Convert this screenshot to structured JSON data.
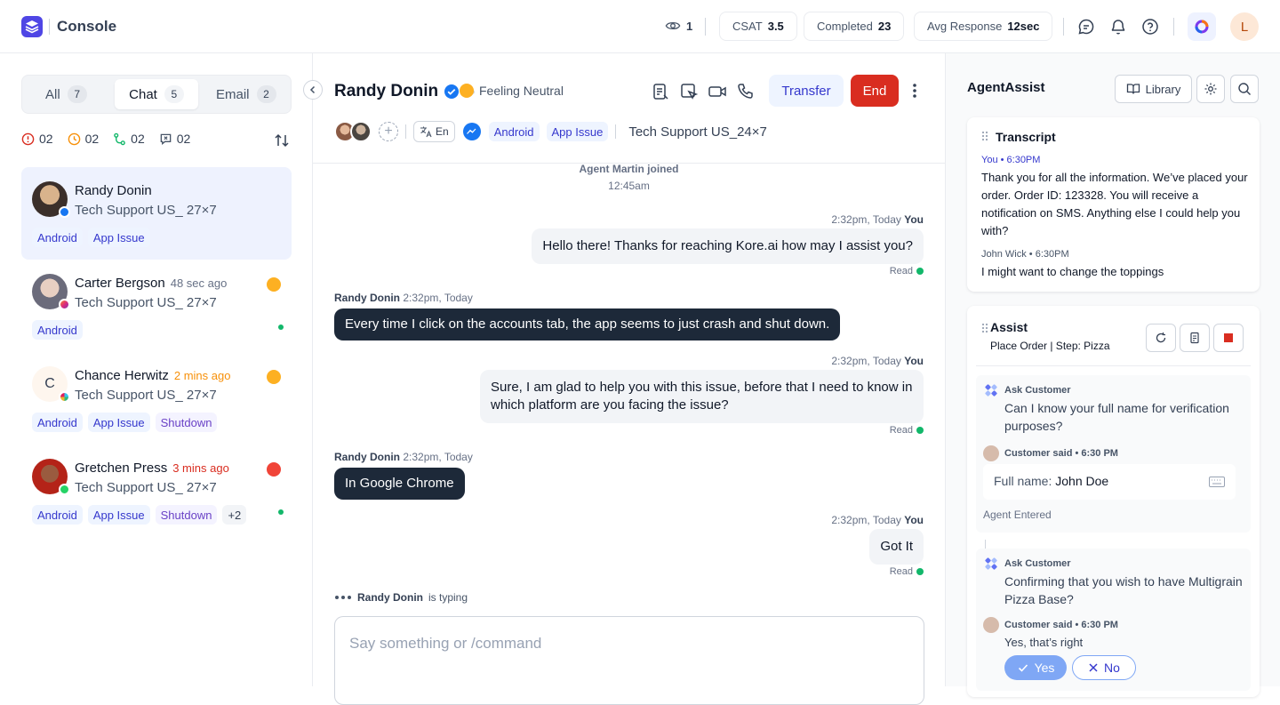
{
  "app": {
    "title": "Console"
  },
  "topbar": {
    "viewers": "1",
    "csat_label": "CSAT",
    "csat_value": "3.5",
    "completed_label": "Completed",
    "completed_value": "23",
    "avg_label": "Avg Response",
    "avg_value": "12sec",
    "user_initial": "L"
  },
  "left": {
    "tabs": [
      {
        "label": "All",
        "count": "7"
      },
      {
        "label": "Chat",
        "count": "5"
      },
      {
        "label": "Email",
        "count": "2"
      }
    ],
    "filters": [
      "02",
      "02",
      "02",
      "02"
    ],
    "conversations": [
      {
        "name": "Randy Donin",
        "time": "",
        "queue": "Tech Support US_ 27×7",
        "tags": [
          "Android",
          "App Issue"
        ]
      },
      {
        "name": "Carter Bergson",
        "time": "48 sec ago",
        "queue": "Tech Support US_ 27×7",
        "tags": [
          "Android"
        ]
      },
      {
        "name": "Chance Herwitz",
        "time": "2 mins ago",
        "queue": "Tech Support US_ 27×7",
        "tags": [
          "Android",
          "App Issue",
          "Shutdown"
        ],
        "initial": "C"
      },
      {
        "name": "Gretchen Press",
        "time": "3 mins ago",
        "queue": "Tech Support US_ 27×7",
        "tags": [
          "Android",
          "App Issue",
          "Shutdown",
          "+2"
        ]
      }
    ]
  },
  "chat": {
    "customer_name": "Randy Donin",
    "mood": "Feeling Neutral",
    "transfer_label": "Transfer",
    "end_label": "End",
    "language": "En",
    "tags": [
      "Android",
      "App Issue"
    ],
    "queue": "Tech Support US_24×7",
    "system_msg": "Agent Martin joined",
    "system_time": "12:45am",
    "messages": [
      {
        "time": "2:32pm, Today",
        "who": "You",
        "text": "Hello there! Thanks for reaching Kore.ai how may I assist you?",
        "status": "Read"
      },
      {
        "time": "2:32pm, Today",
        "who": "Randy Donin",
        "text": "Every time I click on the accounts tab, the app seems to just crash and shut down."
      },
      {
        "time": "2:32pm, Today",
        "who": "You",
        "text": "Sure, I am glad to help you with this issue, before that I need to know in which platform are you facing the issue?",
        "status": "Read"
      },
      {
        "time": "2:32pm, Today",
        "who": "Randy Donin",
        "text": "In Google Chrome"
      },
      {
        "time": "2:32pm, Today",
        "who": "You",
        "text": "Got It",
        "status": "Read"
      }
    ],
    "typing_name": "Randy Donin",
    "typing_text": "is typing",
    "composer_placeholder": "Say something or /command"
  },
  "assist": {
    "title": "AgentAssist",
    "library_label": "Library",
    "transcript": {
      "title": "Transcript",
      "entries": [
        {
          "meta": "You • 6:30PM",
          "text": "Thank you for all the information. We’ve placed your order. Order ID: 123328. You will receive a notification on SMS. Anything else I could help you with?"
        },
        {
          "meta": "John Wick • 6:30PM",
          "text": "I might want to change the toppings"
        }
      ]
    },
    "panel": {
      "title": "Assist",
      "step": "Place Order | Step: Pizza",
      "items": [
        {
          "label": "Ask Customer",
          "question": "Can I know your full name for verification purposes?",
          "said": "Customer said • 6:30 PM",
          "field_label": "Full name:",
          "field_value": "John Doe",
          "note": "Agent Entered"
        },
        {
          "label": "Ask Customer",
          "question": "Confirming that you wish to have Multigrain Pizza Base?",
          "said": "Customer said • 6:30 PM",
          "answer": "Yes, that’s right",
          "yes": "Yes",
          "no": "No"
        }
      ]
    }
  },
  "colors": {
    "accent": "#4f46e5",
    "end": "#d92d20",
    "online": "#12b76a"
  }
}
